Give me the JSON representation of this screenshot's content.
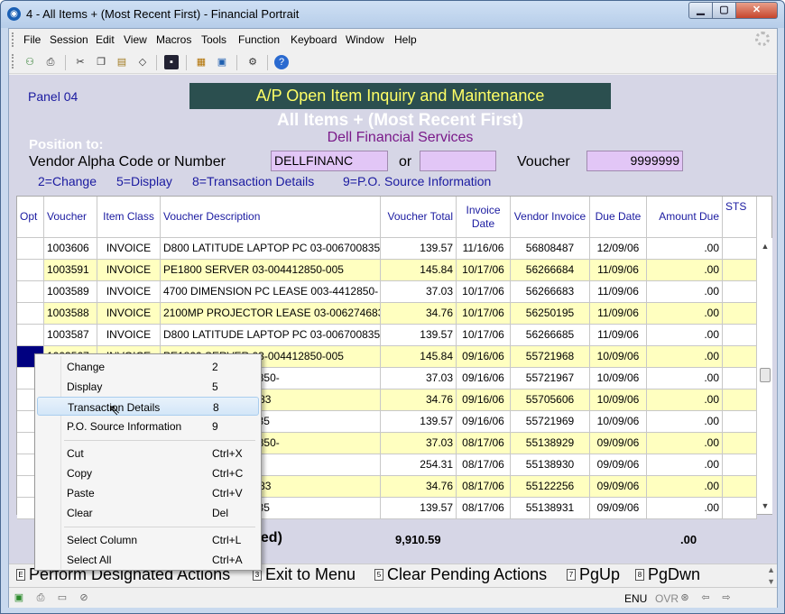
{
  "window": {
    "title": "4 - All Items + (Most Recent First) - Financial Portrait",
    "app_icon": "globe-icon"
  },
  "menu": [
    "File",
    "Session",
    "Edit",
    "View",
    "Macros",
    "Tools",
    "Function",
    "Keyboard",
    "Window",
    "Help"
  ],
  "panel": {
    "label": "Panel 04",
    "title": "A/P Open Item Inquiry and Maintenance",
    "subtitle": "All Items + (Most Recent First)",
    "vendor_name": "Dell Financial Services",
    "position_to": "Position to:",
    "vendor_label": "Vendor Alpha Code or Number",
    "vendor_value": "DELLFINANC",
    "or_label": "or",
    "or_value": "",
    "voucher_label": "Voucher",
    "voucher_value": "9999999",
    "options": [
      "2=Change",
      "5=Display",
      "8=Transaction Details",
      "9=P.O. Source Information"
    ]
  },
  "table": {
    "headers": [
      "Opt",
      "Voucher",
      "Item Class",
      "Voucher Description",
      "Voucher Total",
      "Invoice Date",
      "Vendor Invoice",
      "Due Date",
      "Amount Due",
      "STS"
    ],
    "rows": [
      [
        "",
        "1003606",
        "INVOICE",
        "D800 LATITUDE LAPTOP PC 03-006700835",
        "139.57",
        "11/16/06",
        "56808487",
        "12/09/06",
        ".00",
        ""
      ],
      [
        "",
        "1003591",
        "INVOICE",
        "PE1800 SERVER          03-004412850-005",
        "145.84",
        "10/17/06",
        "56266684",
        "11/09/06",
        ".00",
        ""
      ],
      [
        "",
        "1003589",
        "INVOICE",
        "4700 DIMENSION PC LEASE 003-4412850-",
        "37.03",
        "10/17/06",
        "56266683",
        "11/09/06",
        ".00",
        ""
      ],
      [
        "",
        "1003588",
        "INVOICE",
        "2100MP PROJECTOR LEASE  03-006274683",
        "34.76",
        "10/17/06",
        "56250195",
        "11/09/06",
        ".00",
        ""
      ],
      [
        "",
        "1003587",
        "INVOICE",
        "D800 LATITUDE LAPTOP PC 03-006700835",
        "139.57",
        "10/17/06",
        "56266685",
        "11/09/06",
        ".00",
        ""
      ],
      [
        "",
        "1003567",
        "INVOICE",
        "PE1800 SERVER          03-004412850-005",
        "145.84",
        "09/16/06",
        "55721968",
        "10/09/06",
        ".00",
        ""
      ],
      [
        "",
        "",
        "",
        "C LEASE 003-4412850-",
        "37.03",
        "09/16/06",
        "55721967",
        "10/09/06",
        ".00",
        ""
      ],
      [
        "",
        "",
        "",
        "LEASE  03-006274683",
        "34.76",
        "09/16/06",
        "55705606",
        "10/09/06",
        ".00",
        ""
      ],
      [
        "",
        "",
        "",
        "OP PC 03-006700835",
        "139.57",
        "09/16/06",
        "55721969",
        "10/09/06",
        ".00",
        ""
      ],
      [
        "",
        "",
        "",
        "C LEASE 003-4412850-",
        "37.03",
        "08/17/06",
        "55138929",
        "09/09/06",
        ".00",
        ""
      ],
      [
        "",
        "",
        "",
        "03-004412850-005",
        "254.31",
        "08/17/06",
        "55138930",
        "09/09/06",
        ".00",
        ""
      ],
      [
        "",
        "",
        "",
        "LEASE  03-006274683",
        "34.76",
        "08/17/06",
        "55122256",
        "09/09/06",
        ".00",
        ""
      ],
      [
        "",
        "",
        "",
        "OP PC 03-006700835",
        "139.57",
        "08/17/06",
        "55138931",
        "09/09/06",
        ".00",
        ""
      ]
    ],
    "totals_label": "yed)",
    "voucher_total_sum": "9,910.59",
    "amount_due_sum": ".00"
  },
  "fkeys": [
    {
      "key": "E",
      "label": "Perform Designated Actions"
    },
    {
      "key": "3",
      "label": "Exit to Menu"
    },
    {
      "key": "5",
      "label": "Clear Pending Actions"
    },
    {
      "key": "7",
      "label": "PgUp"
    },
    {
      "key": "8",
      "label": "PgDwn"
    }
  ],
  "status": {
    "lang": "ENU",
    "ovr": "OVR"
  },
  "context_menu": [
    {
      "label": "Change",
      "shortcut": "2"
    },
    {
      "label": "Display",
      "shortcut": "5"
    },
    {
      "label": "Transaction Details",
      "shortcut": "8"
    },
    {
      "label": "P.O. Source Information",
      "shortcut": "9"
    },
    {
      "label": "Cut",
      "shortcut": "Ctrl+X"
    },
    {
      "label": "Copy",
      "shortcut": "Ctrl+C"
    },
    {
      "label": "Paste",
      "shortcut": "Ctrl+V"
    },
    {
      "label": "Clear",
      "shortcut": "Del"
    },
    {
      "label": "Select Column",
      "shortcut": "Ctrl+L"
    },
    {
      "label": "Select All",
      "shortcut": "Ctrl+A"
    }
  ],
  "colors": {
    "panel_bg": "#d6d6e6",
    "banner_bg": "#2b4f4f",
    "banner_fg": "#ffff66",
    "row_yellow": "#ffffc0",
    "input_bg": "#e2c6f6",
    "selected_opt": "#000080"
  }
}
